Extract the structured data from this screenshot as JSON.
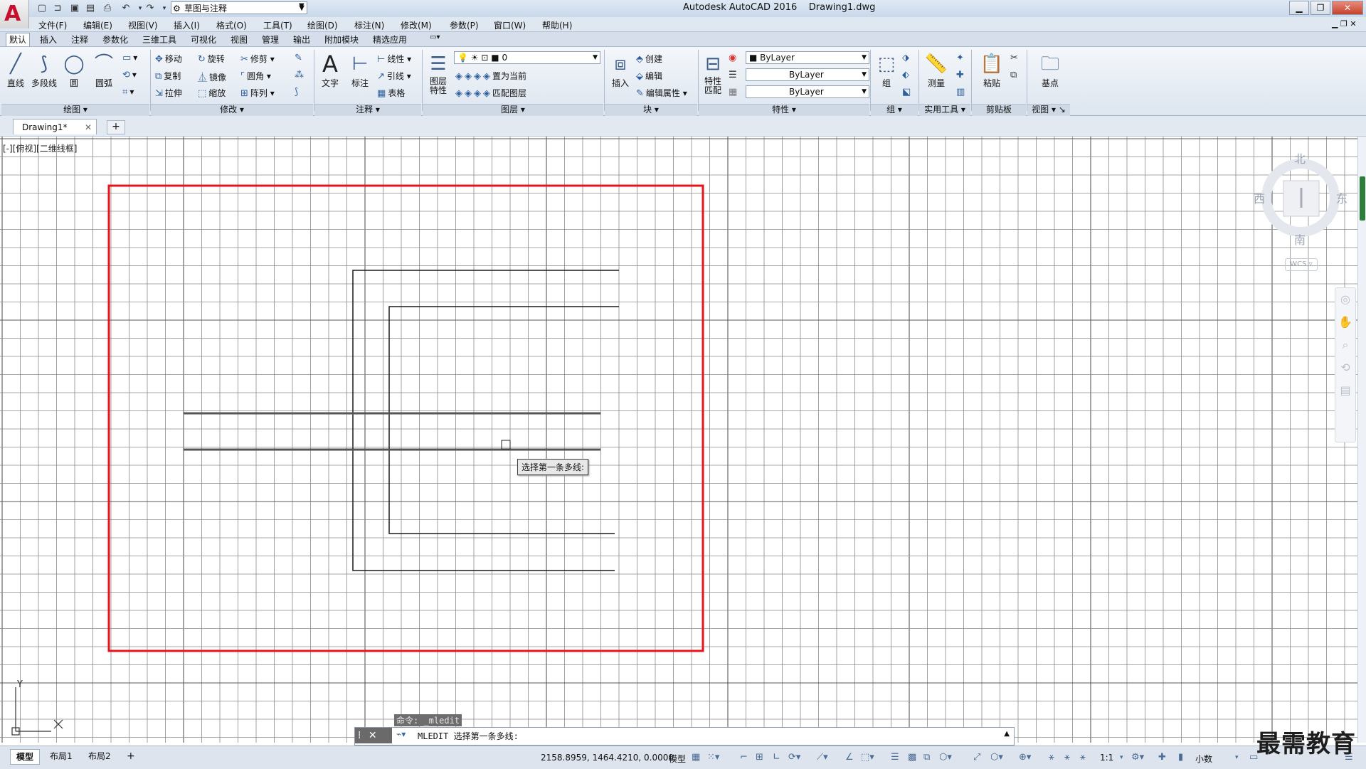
{
  "title": {
    "app": "Autodesk AutoCAD 2016",
    "file": "Drawing1.dwg",
    "workspace": "草图与注释"
  },
  "menu": [
    "文件(F)",
    "编辑(E)",
    "视图(V)",
    "插入(I)",
    "格式(O)",
    "工具(T)",
    "绘图(D)",
    "标注(N)",
    "修改(M)",
    "参数(P)",
    "窗口(W)",
    "帮助(H)"
  ],
  "ribbon_tabs": [
    "默认",
    "插入",
    "注释",
    "参数化",
    "三维工具",
    "可视化",
    "视图",
    "管理",
    "输出",
    "附加模块",
    "精选应用"
  ],
  "ribbon": {
    "draw": {
      "line": "直线",
      "polyline": "多段线",
      "circle": "圆",
      "arc": "圆弧",
      "title": "绘图"
    },
    "modify": {
      "move": "移动",
      "rotate": "旋转",
      "trim": "修剪",
      "copy": "复制",
      "mirror": "镜像",
      "fillet": "圆角",
      "stretch": "拉伸",
      "scale": "缩放",
      "array": "阵列",
      "title": "修改"
    },
    "annotation": {
      "text": "文字",
      "dimension": "标注",
      "linear": "线性",
      "leader": "引线",
      "table": "表格",
      "title": "注释"
    },
    "layers": {
      "properties": "图层\n特性",
      "layer_value": "0",
      "set_current": "置为当前",
      "match_layer": "匹配图层",
      "title": "图层"
    },
    "block": {
      "insert": "插入",
      "create": "创建",
      "edit": "编辑",
      "edit_attr": "编辑属性",
      "title": "块"
    },
    "properties": {
      "match": "特性\n匹配",
      "color": "ByLayer",
      "linetype": "ByLayer",
      "lineweight": "ByLayer",
      "title": "特性"
    },
    "groups": {
      "group": "组",
      "title": "组"
    },
    "utilities": {
      "measure": "测量",
      "title": "实用工具"
    },
    "clipboard": {
      "paste": "粘贴",
      "title": "剪贴板"
    },
    "view": {
      "base": "基点",
      "title": "视图"
    }
  },
  "file_tab": {
    "name": "Drawing1*"
  },
  "viewport_label": "[-][俯视][二维线框]",
  "viewcube": {
    "north": "北",
    "south": "南",
    "east": "东",
    "west": "西",
    "wcs": "WCS"
  },
  "tooltip": "选择第一条多线:",
  "command": {
    "history": "命令: _mledit",
    "prompt": "MLEDIT 选择第一条多线:"
  },
  "ucs": {
    "x": "X",
    "y": "Y"
  },
  "status": {
    "layouts": [
      "模型",
      "布局1",
      "布局2"
    ],
    "coords": "2158.8959, 1464.4210, 0.0000",
    "model": "模型",
    "scale": "1:1",
    "units": "小数"
  },
  "watermark": "最需教育",
  "colors": {
    "highlight_frame": "#e8141c",
    "grid": "#808080"
  }
}
